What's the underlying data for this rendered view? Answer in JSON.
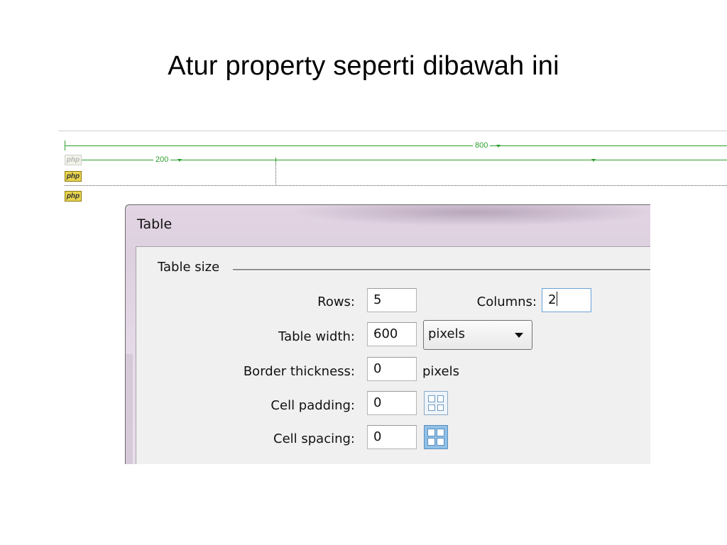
{
  "slide": {
    "title": "Atur property seperti dibawah ini"
  },
  "design_view": {
    "outer_width_label": "800",
    "inner_width_label": "200",
    "php_icon_label": "php"
  },
  "dialog": {
    "title": "Table",
    "group_title": "Table size",
    "rows_label": "Rows:",
    "rows_value": "5",
    "columns_label": "Columns:",
    "columns_value": "2",
    "table_width_label": "Table width:",
    "table_width_value": "600",
    "table_width_unit": "pixels",
    "border_thickness_label": "Border thickness:",
    "border_thickness_value": "0",
    "border_thickness_unit": "pixels",
    "cell_padding_label": "Cell padding:",
    "cell_padding_value": "0",
    "cell_spacing_label": "Cell spacing:",
    "cell_spacing_value": "0"
  },
  "colors": {
    "ruler_green": "#2e9e2e",
    "focus_blue": "#6aa2d8"
  },
  "icons": {
    "cell_padding": "table-cell-padding-icon",
    "cell_spacing": "table-cell-spacing-icon",
    "dropdown": "chevron-down-icon"
  }
}
